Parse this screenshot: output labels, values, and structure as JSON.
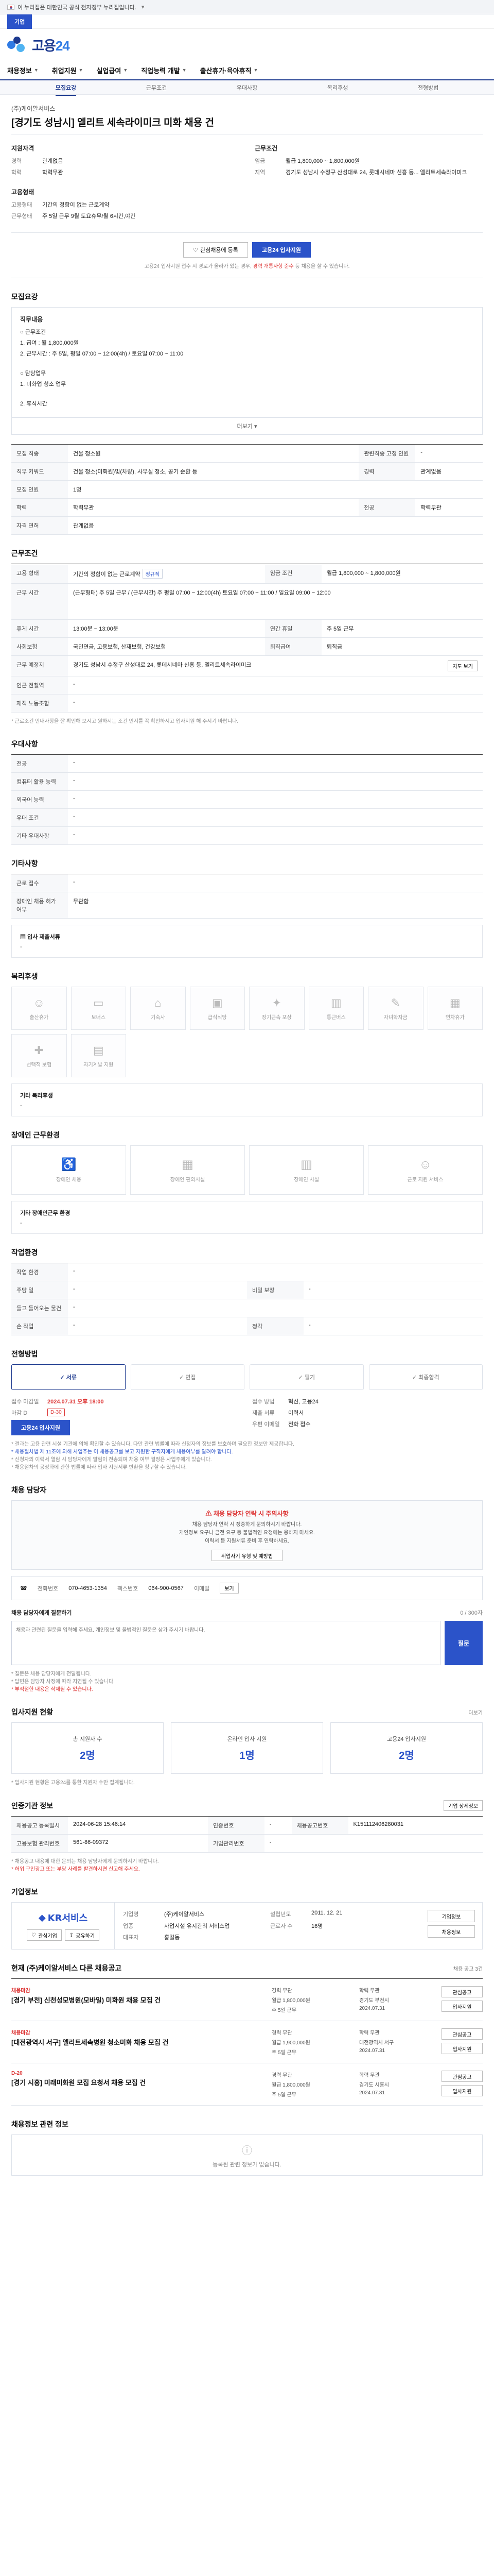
{
  "gov_banner": {
    "text": "이 누리집은 대한민국 공식 전자정부 누리집입니다."
  },
  "topbar": {
    "items": [
      "기업"
    ]
  },
  "logo": {
    "text": "고용",
    "number": "24"
  },
  "gnb": {
    "items": [
      "채용정보",
      "취업지원",
      "실업급여",
      "직업능력 개발",
      "출산휴가·육아휴직"
    ]
  },
  "sub_tabs": [
    "모집요강",
    "근무조건",
    "우대사항",
    "복리후생",
    "전형방법"
  ],
  "job": {
    "company": "(주)케이알서비스",
    "title": "[경기도 성남시] 엘리트 세속라이미크 미화 채용 건"
  },
  "summary": {
    "left_title": "지원자격",
    "left": [
      {
        "k": "경력",
        "v": "관계없음"
      },
      {
        "k": "학력",
        "v": "학력무관"
      }
    ],
    "right_title": "근무조건",
    "right": [
      {
        "k": "임금",
        "v": "월급 1,800,000 ~ 1,800,000원"
      },
      {
        "k": "지역",
        "v": "경기도 성남시 수정구 산성대로 24, 롯데시네마 신흥 등... 엘리트세속라이미크"
      }
    ],
    "left2_title": "고용형태",
    "left2": [
      {
        "k": "고용형태",
        "v": "기간의 정함이 없는 근로계약"
      },
      {
        "k": "근무형태",
        "v": "주 5일 근무 9월 토요휴무/월 6시간,야간"
      }
    ]
  },
  "buttons": {
    "save": "관심채용에 등록",
    "apply": "고용24 입사지원"
  },
  "notice": {
    "pre": "고용24 입사지원 접수 시 경로가 올라가 있는 경우,",
    "red": "경력 개통사항 준수",
    "post": "등 채용을 할 수 있습니다."
  },
  "recruit": {
    "title": "모집요강",
    "box_heading": "직무내용",
    "duties": [
      "○ 근무조건",
      "1. 급여 : 월 1,800,000원",
      "2. 근무시간 : 주 5일, 평일 07:00 ~ 12:00(4h) / 토요일 07:00 ~ 11:00",
      "",
      "○ 담당업무",
      "1. 미화업 청소 업무",
      "",
      "2. 휴식시간"
    ],
    "expand": "더보기",
    "rows": [
      {
        "k": "모집 직종",
        "v": "건물 청소원",
        "k2": "관련직종 고정 인원",
        "v2": "-"
      },
      {
        "k": "직무 키워드",
        "v": "건물 청소(미화원)및(차량), 사무실 청소, 공기 순환 등",
        "k2": "경력",
        "v2": "관계없음"
      },
      {
        "k": "모집 인원",
        "v": "1명",
        "k2": "",
        "v2": ""
      },
      {
        "k": "학력",
        "v": "학력무관",
        "k2": "전공",
        "v2": "학력무관"
      },
      {
        "k": "자격 면허",
        "v": "관계없음",
        "k2": "",
        "v2": ""
      }
    ]
  },
  "conditions": {
    "title": "근무조건",
    "rows": [
      {
        "k": "고용 형태",
        "v": "기간의 정함이 없는 근로계약",
        "tag": "정규직",
        "k2": "임금 조건",
        "v2": "월급 1,800,000 ~ 1,800,000원"
      },
      {
        "k": "근무 시간",
        "v": "(근무형태) 주 5일 근무 / (근무시간) 주 평일 07:00 ~ 12:00(4h) 토요일 07:00 ~ 11:00 / 일요일 09:00 ~ 12:00",
        "k2": "",
        "v2": ""
      },
      {
        "k": "휴게 시간",
        "v": "13:00분 ~ 13:00분",
        "k2": "연간 휴일",
        "v2": "주 5일 근무"
      },
      {
        "k": "사회보험",
        "v": "국민연금, 고용보험, 산재보험, 건강보험",
        "k2": "퇴직급여",
        "v2": "퇴직금"
      },
      {
        "k": "근무 예정지",
        "v": "경기도 성남시 수정구 산성대로 24, 롯데시네마 신흥 등, 엘리트세속라이미크",
        "k2": "",
        "v2": ""
      },
      {
        "k": "인근 전철역",
        "v": "-",
        "k2": "",
        "v2": ""
      },
      {
        "k": "재직 노동조합",
        "v": "-",
        "k2": "",
        "v2": ""
      }
    ],
    "map_btn": "지도 보기",
    "footnote": "* 근로조건 안내사항을 잘 확인해 보시고 원하시는 조건 인지를 꼭 확인하시고 입사지원 해 주시기 바랍니다."
  },
  "preferred": {
    "title": "우대사항",
    "rows": [
      {
        "k": "전공",
        "v": "-"
      },
      {
        "k": "컴퓨터 활용 능력",
        "v": "-"
      },
      {
        "k": "외국어 능력",
        "v": "-"
      },
      {
        "k": "우대 조건",
        "v": "-"
      },
      {
        "k": "기타 우대사항",
        "v": "-"
      }
    ]
  },
  "other_info": {
    "title": "기타사항",
    "rows": [
      {
        "k": "근로 접수",
        "v": "-"
      },
      {
        "k": "장애인 채용 허가 여부",
        "v": "무관함"
      }
    ],
    "doc_title": "입사 제출서류",
    "doc_value": "-"
  },
  "welfare": {
    "title": "복리후생",
    "icons": [
      "출산휴가",
      "보너스",
      "기숙사",
      "급식식당",
      "장기근속 포상",
      "통근버스",
      "자녀학자금",
      "연차휴가",
      "선택적 보험",
      "자기계발 지원"
    ],
    "box_title": "기타 복리후생",
    "box_value": "-"
  },
  "env": {
    "title": "장애인 근무환경",
    "icons": [
      "장애인 채용",
      "장애인 편의시설",
      "장애인 시설",
      "근로 지원 서비스"
    ],
    "box_title": "기타 장애인근무 환경",
    "box_value": "-"
  },
  "work_env": {
    "title": "작업환경",
    "rows": [
      {
        "k": "작업 환경",
        "v": "-",
        "k2": "",
        "v2": ""
      },
      {
        "k": "주당 일",
        "v": "-",
        "k2": "비밀 보장",
        "v2": "-"
      },
      {
        "k": "들고 들어오는 물건",
        "v": "-",
        "k2": "",
        "v2": ""
      },
      {
        "k": "손 작업",
        "v": "-",
        "k2": "청각",
        "v2": "-"
      }
    ]
  },
  "process": {
    "title": "전형방법",
    "steps": [
      "서류",
      "면접",
      "필기",
      "최종합격"
    ],
    "apply_left": [
      {
        "k": "접수 마감일",
        "v": "2024.07.31 오후 18:00"
      },
      {
        "k": "마감 D",
        "v": "D-30"
      }
    ],
    "apply_right": [
      {
        "k": "접수 방법",
        "v": "혁신, 고용24"
      },
      {
        "k": "제출 서류",
        "v": "이력서"
      },
      {
        "k": "우편 이메일",
        "v": "전화 접수"
      }
    ],
    "apply_btn": "고용24 입사지원",
    "notes": [
      "* 결과는 고용 관련 시설 기관에 의해 확인할 수 있습니다. 다만 관련 법률에 따라 신청자의 정보를 보호하며 필요한 정보만 제공합니다.",
      "* 채용절차법 제 11조에 의해 사업주는 이 채용공고를 보고 지원한 구직자에게 채용여부를 알려야 합니다.",
      "* 신청자의 이력서 열람 시 담당자에게 알림이 전송되며 채용 여부 결정은 사업주에게 있습니다.",
      "* 채용절차의 공정화에 관한 법률에 따라 입사 지원서류 반환을 청구할 수 있습니다."
    ]
  },
  "contact": {
    "title": "채용 담당자",
    "warn": "채용 담당자 연락 시 주의사항",
    "lines": [
      "채용 담당자 연락 시 정중하게 문의하시기 바랍니다.",
      "개인정보 요구나 금전 요구 등 불법적인 요청에는 응하지 마세요.",
      "이력서 등 지원서류 준비 후 연락하세요."
    ],
    "link": "취업사기 유형 및 예방법",
    "phone_label": "전화번호",
    "phone": "070-4653-1354",
    "fax_label": "팩스번호",
    "fax": "064-900-0567",
    "email_label": "이메일",
    "email_btn": "보기",
    "qna_title": "채용 담당자에게 질문하기",
    "qna_count": "0 / 300자",
    "qna_placeholder": "채용과 관련된 질문을 입력해 주세요. 개인정보 및 불법적인 질문은 삼가 주시기 바랍니다.",
    "qna_send": "질문",
    "qna_notes": [
      "* 질문은 채용 담당자에게 전달됩니다.",
      "* 답변은 담당자 사정에 따라 지연될 수 있습니다.",
      "* 부적절한 내용은 삭제될 수 있습니다."
    ],
    "qna_link": "채용 질문하기"
  },
  "stats": {
    "title": "입사지원 현황",
    "more": "더보기",
    "items": [
      {
        "lbl": "총 지원자 수",
        "num": "2명"
      },
      {
        "lbl": "온라인 입사 지원",
        "num": "1명"
      },
      {
        "lbl": "고용24 입사지원",
        "num": "2명"
      }
    ],
    "note": "* 입사지원 현황은 고용24를 통한 지원자 수만 집계됩니다."
  },
  "reg_info": {
    "title": "인증기관 정보",
    "btn": "기업 상세정보",
    "rows": [
      {
        "k": "채용공고 등록일시",
        "v": "2024-06-28 15:46:14",
        "k2": "인증번호",
        "v2": "-",
        "k3": "채용공고번호",
        "v3": "K151112406280031"
      },
      {
        "k": "고용보험 관리번호",
        "v": "561-86-09372",
        "k2": "기업관리번호",
        "v2": "-",
        "k3": "",
        "v3": ""
      }
    ],
    "notes": [
      "* 채용공고 내용에 대한 문의는 채용 담당자에게 문의하시기 바랍니다.",
      "* 허위 구인광고 또는 부당 사례를 발견하시면 신고해 주세요."
    ]
  },
  "company": {
    "title": "기업정보",
    "logo": "KR서비스",
    "btn_heart": "관심기업",
    "btn_share": "공유하기",
    "info": [
      {
        "k": "기업명",
        "v": "(주)케이알서비스"
      },
      {
        "k": "설립년도",
        "v": "2011. 12. 21"
      },
      {
        "k": "업종",
        "v": "사업시설 유지관리 서비스업"
      },
      {
        "k": "근로자 수",
        "v": "16명"
      },
      {
        "k": "대표자",
        "v": "홍길동"
      },
      {
        "k": "",
        "v": ""
      }
    ],
    "actions": [
      "기업정보",
      "채용정보"
    ]
  },
  "other_jobs": {
    "title": "현재 (주)케이알서비스 다른 채용공고",
    "count": "채용 공고 3건",
    "items": [
      {
        "dd": "채용마감",
        "title": "[경기 부천] 신천성모병원(모바일) 미화원 채용 모집 건",
        "meta": [
          "경력 무관",
          "학력 무관",
          "월급 1,800,000원",
          "경기도 부천시",
          "주 5일 근무",
          "2024.07.31"
        ],
        "actions": [
          "관심공고",
          "입사지원"
        ]
      },
      {
        "dd": "채용마감",
        "title": "[대전광역시 서구] 엘리트세속병원 청소미화 채용 모집 건",
        "meta": [
          "경력 무관",
          "학력 무관",
          "월급 1,900,000원",
          "대전광역시 서구",
          "주 5일 근무",
          "2024.07.31"
        ],
        "actions": [
          "관심공고",
          "입사지원"
        ]
      },
      {
        "dd": "D-20",
        "title": "[경기 시흥] 미래미화원 모집 요청서 채용 모집 건",
        "meta": [
          "경력 무관",
          "학력 무관",
          "월급 1,800,000원",
          "경기도 시흥시",
          "주 5일 근무",
          "2024.07.31"
        ],
        "actions": [
          "관심공고",
          "입사지원"
        ]
      }
    ]
  },
  "related": {
    "title": "채용정보 관련 정보",
    "empty": "등록된 관련 정보가 없습니다."
  }
}
